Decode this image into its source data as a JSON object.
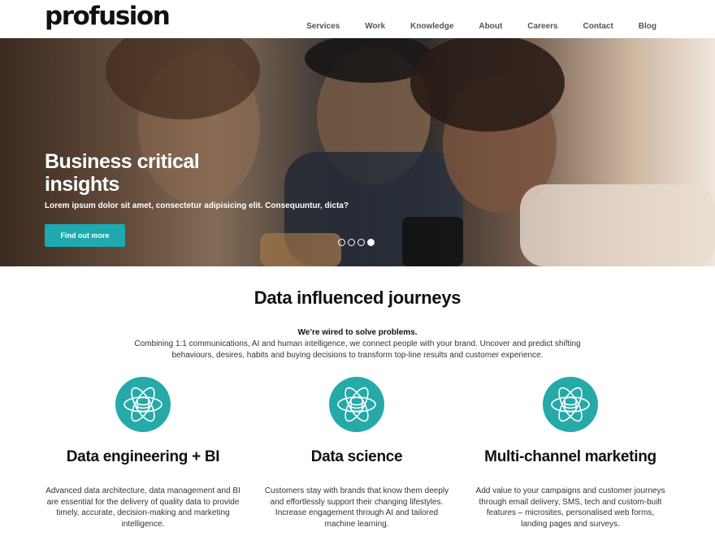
{
  "header": {
    "logo": "profusion",
    "nav": [
      "Services",
      "Work",
      "Knowledge",
      "About",
      "Careers",
      "Contact",
      "Blog"
    ]
  },
  "hero": {
    "title": "Business critical insights",
    "subtitle": "Lorem ipsum dolor sit amet, consectetur adipisicing elit. Consequuntur, dicta?",
    "button_label": "Find out more",
    "slides_total": 4,
    "active_slide": 4
  },
  "intro": {
    "title": "Data influenced journeys",
    "bold_line": "We’re wired to solve problems.",
    "text": "Combining 1:1 communications, AI and human intelligence, we connect people with your brand. Uncover and predict shifting behaviours, desires, habits and buying decisions to transform top-line results and customer experience."
  },
  "features": [
    {
      "icon": "database-atom-icon",
      "title": "Data engineering + BI",
      "text": "Advanced data architecture, data management and BI are essential for the delivery of quality data to provide timely, accurate, decision-making and marketing intelligence."
    },
    {
      "icon": "database-atom-icon",
      "title": "Data science",
      "text": "Customers stay with brands that know them deeply and effortlessly support their changing lifestyles. Increase engagement through AI and tailored machine learning."
    },
    {
      "icon": "database-atom-icon",
      "title": "Multi-channel marketing",
      "text": "Add value to your campaigns and customer journeys through email delivery, SMS, tech and custom-built features – microsites, personalised web forms, landing pages and surveys."
    }
  ],
  "colors": {
    "accent": "#1eaaae",
    "icon_bg": "#25a9a9"
  }
}
